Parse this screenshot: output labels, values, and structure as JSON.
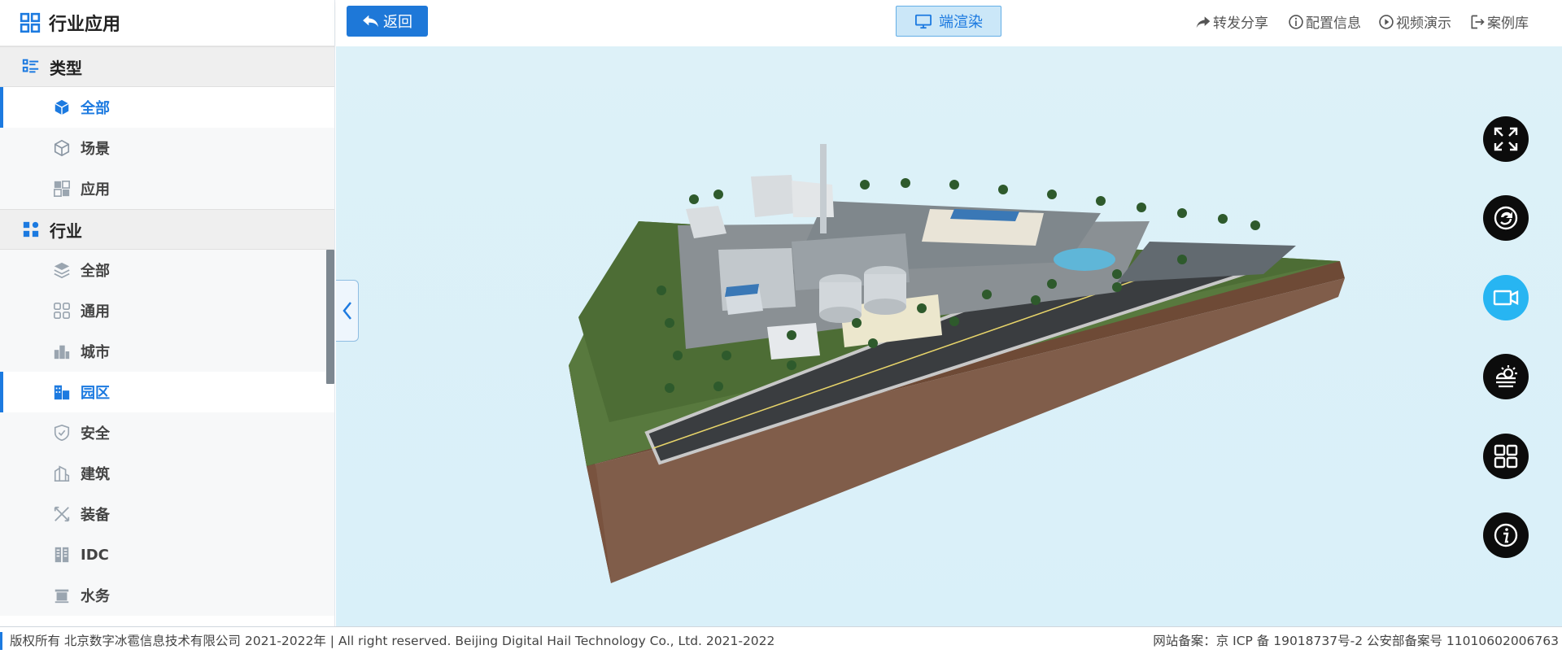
{
  "sidebar": {
    "title": "行业应用",
    "sections": [
      {
        "label": "类型",
        "items": [
          {
            "label": "全部",
            "active": true
          },
          {
            "label": "场景",
            "active": false
          },
          {
            "label": "应用",
            "active": false
          }
        ]
      },
      {
        "label": "行业",
        "items": [
          {
            "label": "全部",
            "active": false
          },
          {
            "label": "通用",
            "active": false
          },
          {
            "label": "城市",
            "active": false
          },
          {
            "label": "园区",
            "active": true
          },
          {
            "label": "安全",
            "active": false
          },
          {
            "label": "建筑",
            "active": false
          },
          {
            "label": "装备",
            "active": false
          },
          {
            "label": "IDC",
            "active": false
          },
          {
            "label": "水务",
            "active": false
          }
        ]
      }
    ]
  },
  "topbar": {
    "back_label": "返回",
    "render_label": "端渲染",
    "links": [
      {
        "label": "转发分享",
        "icon": "share-icon"
      },
      {
        "label": "配置信息",
        "icon": "info-icon"
      },
      {
        "label": "视频演示",
        "icon": "play-icon"
      },
      {
        "label": "案例库",
        "icon": "exit-icon"
      }
    ]
  },
  "toolbar": [
    {
      "icon": "fullscreen-icon",
      "active": false
    },
    {
      "icon": "rotate-icon",
      "active": false
    },
    {
      "icon": "camera-icon",
      "active": true
    },
    {
      "icon": "weather-icon",
      "active": false
    },
    {
      "icon": "grid-icon",
      "active": false
    },
    {
      "icon": "info-circle-icon",
      "active": false
    }
  ],
  "footer": {
    "left": "版权所有 北京数字冰雹信息技术有限公司 2021-2022年 | All right reserved. Beijing Digital Hail Technology Co., Ltd. 2021-2022",
    "right": "网站备案：京 ICP 备 19018737号-2 公安部备案号 11010602006763"
  },
  "colors": {
    "accent": "#1c7ae0",
    "active_tool": "#27b5f2",
    "viewport_bg": "#dcf0f8"
  }
}
